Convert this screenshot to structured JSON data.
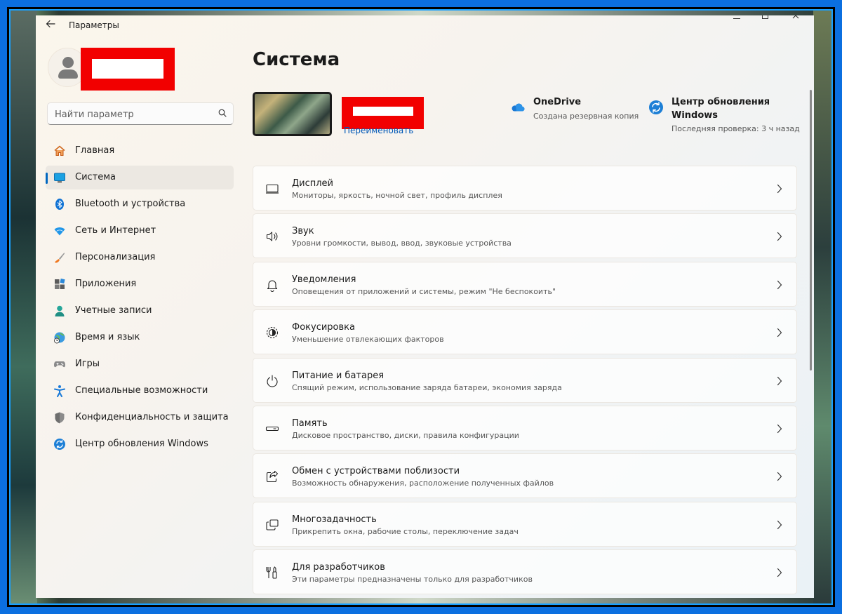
{
  "window": {
    "title": "Параметры"
  },
  "search": {
    "placeholder": "Найти параметр"
  },
  "sidebar": {
    "items": [
      {
        "label": "Главная",
        "icon": "home-icon"
      },
      {
        "label": "Система",
        "icon": "system-icon",
        "active": true
      },
      {
        "label": "Bluetooth и устройства",
        "icon": "bluetooth-icon"
      },
      {
        "label": "Сеть и Интернет",
        "icon": "wifi-icon"
      },
      {
        "label": "Персонализация",
        "icon": "brush-icon"
      },
      {
        "label": "Приложения",
        "icon": "apps-icon"
      },
      {
        "label": "Учетные записи",
        "icon": "account-icon"
      },
      {
        "label": "Время и язык",
        "icon": "globe-clock-icon"
      },
      {
        "label": "Игры",
        "icon": "gamepad-icon"
      },
      {
        "label": "Специальные возможности",
        "icon": "accessibility-icon"
      },
      {
        "label": "Конфиденциальность и защита",
        "icon": "shield-icon"
      },
      {
        "label": "Центр обновления Windows",
        "icon": "update-icon"
      }
    ]
  },
  "main": {
    "title": "Система",
    "rename_label": "Переименовать",
    "onedrive": {
      "title": "OneDrive",
      "subtitle": "Создана резервная копия"
    },
    "windows_update": {
      "title": "Центр обновления Windows",
      "subtitle": "Последняя проверка: 3 ч назад"
    },
    "settings": [
      {
        "title": "Дисплей",
        "subtitle": "Мониторы, яркость, ночной свет, профиль дисплея",
        "icon": "display-icon"
      },
      {
        "title": "Звук",
        "subtitle": "Уровни громкости, вывод, ввод, звуковые устройства",
        "icon": "speaker-icon"
      },
      {
        "title": "Уведомления",
        "subtitle": "Оповещения от приложений и системы, режим \"Не беспокоить\"",
        "icon": "bell-icon"
      },
      {
        "title": "Фокусировка",
        "subtitle": "Уменьшение отвлекающих факторов",
        "icon": "focus-icon"
      },
      {
        "title": "Питание и батарея",
        "subtitle": "Спящий режим, использование заряда батареи, экономия заряда",
        "icon": "power-icon"
      },
      {
        "title": "Память",
        "subtitle": "Дисковое пространство, диски, правила конфигурации",
        "icon": "storage-icon"
      },
      {
        "title": "Обмен с устройствами поблизости",
        "subtitle": "Возможность обнаружения, расположение полученных файлов",
        "icon": "share-icon"
      },
      {
        "title": "Многозадачность",
        "subtitle": "Прикрепить окна, рабочие столы, переключение задач",
        "icon": "multitask-icon"
      },
      {
        "title": "Для разработчиков",
        "subtitle": "Эти параметры предназначены только для разработчиков",
        "icon": "developer-tools-icon"
      }
    ]
  },
  "colors": {
    "accent": "#0067c0",
    "frame": "#0b6fe0",
    "redaction": "#f20000"
  }
}
